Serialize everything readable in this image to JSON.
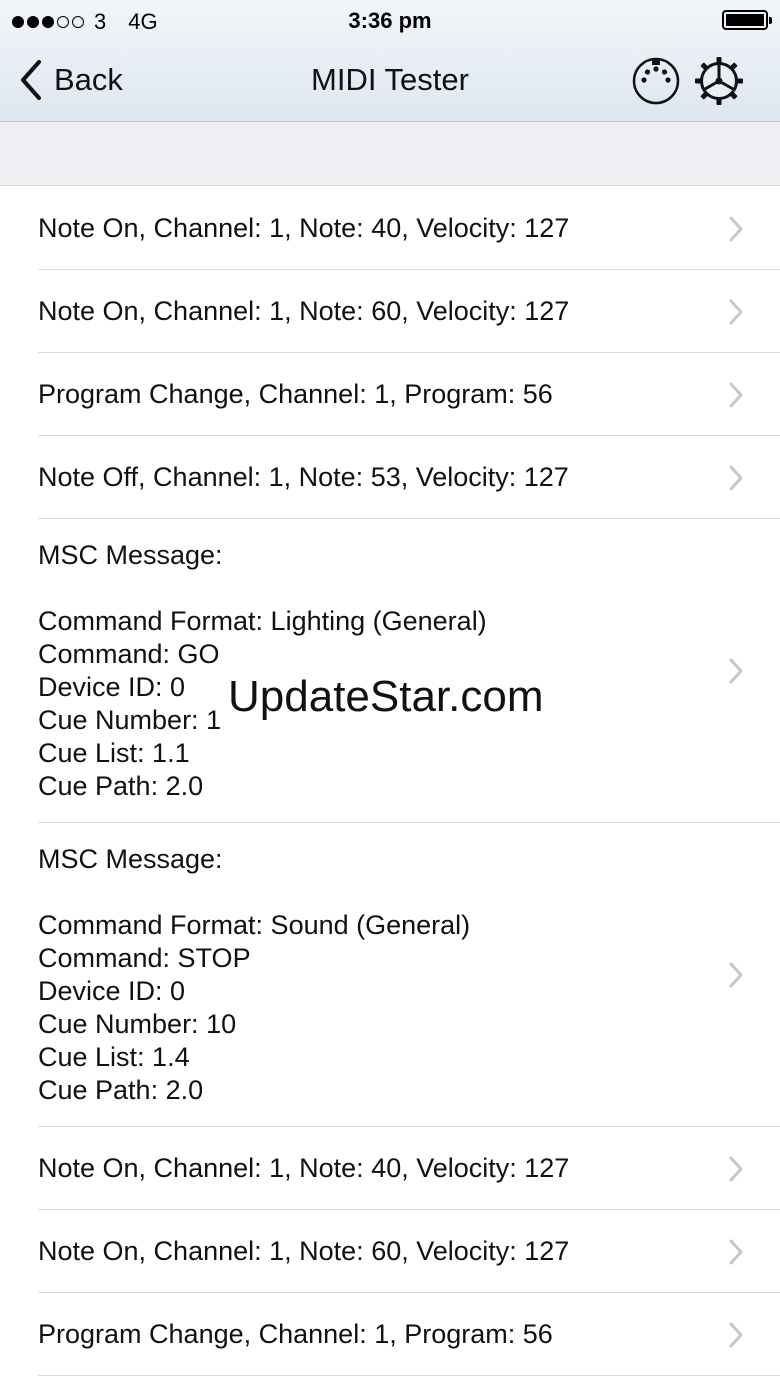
{
  "status_bar": {
    "carrier": "3",
    "network": "4G",
    "time": "3:36 pm",
    "signal_strength": 3,
    "signal_max": 5,
    "battery_level": 1.0
  },
  "nav": {
    "back_label": "Back",
    "title": "MIDI Tester",
    "back_icon": "chevron-left-icon",
    "midi_icon": "midi-connector-icon",
    "settings_icon": "gear-icon"
  },
  "messages": [
    {
      "text": "Note On, Channel: 1, Note: 40, Velocity: 127"
    },
    {
      "text": "Note On, Channel: 1, Note: 60, Velocity: 127"
    },
    {
      "text": "Program Change, Channel: 1, Program: 56"
    },
    {
      "text": "Note Off, Channel: 1, Note: 53, Velocity: 127"
    },
    {
      "text": "MSC Message:\n\nCommand Format: Lighting (General)\nCommand: GO\nDevice ID: 0\nCue Number: 1\nCue List: 1.1\nCue Path: 2.0"
    },
    {
      "text": "MSC Message:\n\nCommand Format: Sound (General)\nCommand: STOP\nDevice ID: 0\nCue Number: 10\nCue List: 1.4\nCue Path: 2.0"
    },
    {
      "text": "Note On, Channel: 1, Note: 40, Velocity: 127"
    },
    {
      "text": "Note On, Channel: 1, Note: 60, Velocity: 127"
    },
    {
      "text": "Program Change, Channel: 1, Program: 56"
    }
  ],
  "watermark": "UpdateStar.com",
  "colors": {
    "nav_gradient_top": "#f3f6fa",
    "nav_gradient_bottom": "#dde6f0",
    "chevron": "#c7c7cc",
    "separator": "#d9d9de"
  }
}
